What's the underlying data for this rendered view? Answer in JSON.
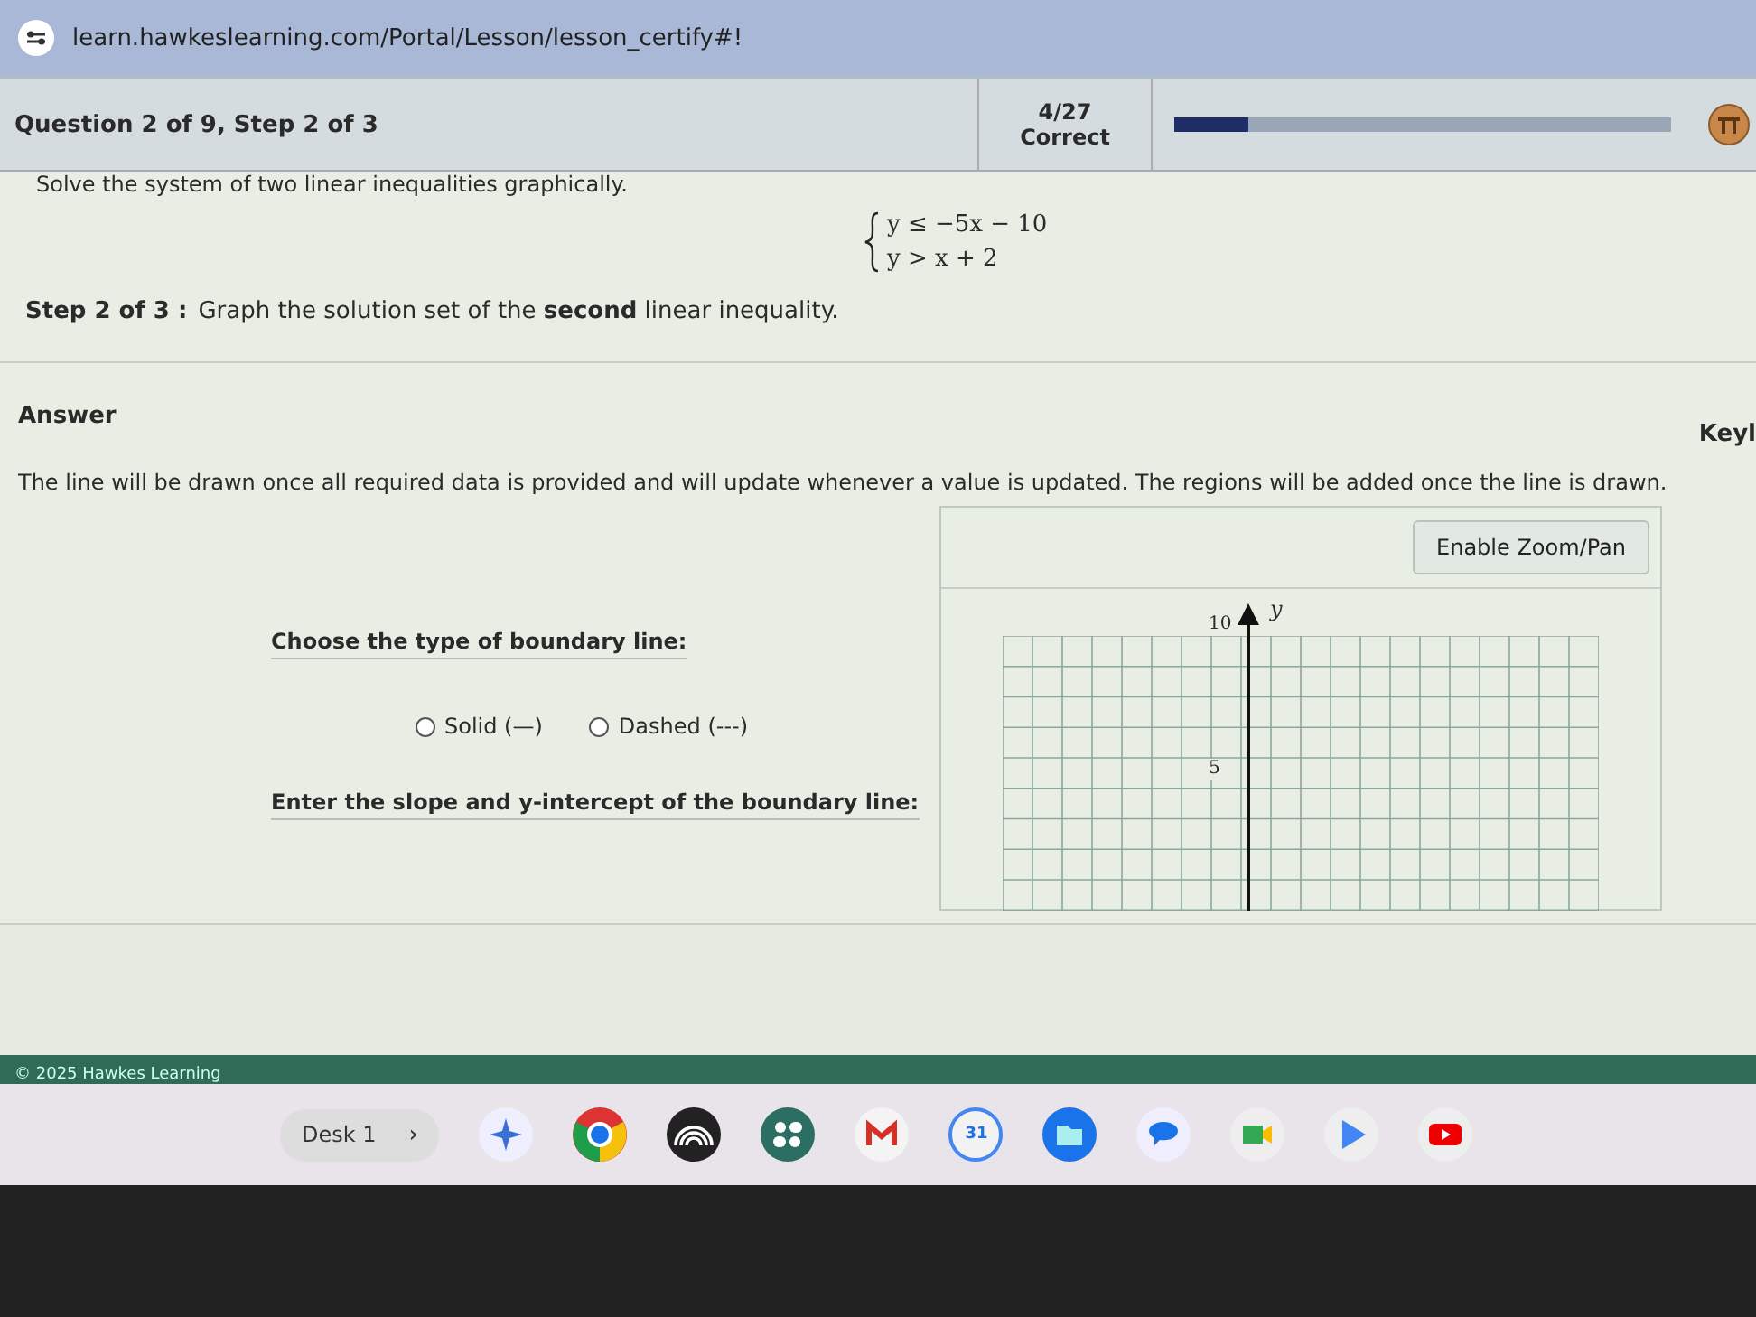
{
  "browser": {
    "url": "learn.hawkeslearning.com/Portal/Lesson/lesson_certify#!"
  },
  "header": {
    "question": "Question 2 of 9, Step 2 of 3",
    "score": "4/27",
    "status": "Correct",
    "progress": {
      "level": 0.15
    }
  },
  "instructions": "Solve the system of two linear inequalities graphically.",
  "system": [
    "y ≤ −5x − 10",
    "y > x + 2"
  ],
  "step": {
    "label": "Step 2 of 3 :",
    "text": "Graph the solution set of the **second** linear inequality."
  },
  "answer": {
    "heading": "Answer",
    "key_link": "Keyl",
    "note": "The line will be drawn once all required data is provided and will update whenever a value is updated. The regions will be added once the line is drawn.",
    "boundary_prompt": "Choose the type of boundary line:",
    "options": [
      {
        "label": "Solid (—)",
        "selected": false
      },
      {
        "label": "Dashed (---)",
        "selected": false
      }
    ],
    "slope_prompt": "Enter the slope and y-intercept of the boundary line:",
    "zoom_button": "Enable Zoom/Pan",
    "graph": {
      "axis_label": "y",
      "tick_labels": [
        "10",
        "5"
      ]
    }
  },
  "footer": {
    "copyright": "© 2025 Hawkes Learning"
  },
  "taskbar": {
    "desk": "Desk 1",
    "chevron": "›",
    "calendar_day": "31"
  }
}
